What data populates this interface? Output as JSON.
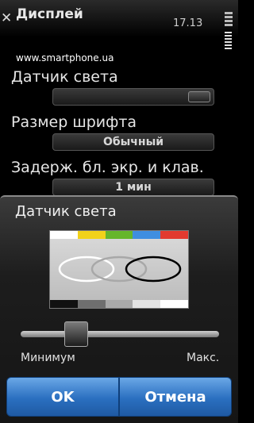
{
  "header": {
    "title": "Дисплей",
    "time": "17.13"
  },
  "watermark": "www.smartphone.ua",
  "settings": [
    {
      "label": "Датчик света",
      "value": ""
    },
    {
      "label": "Размер шрифта",
      "value": "Обычный"
    },
    {
      "label": "Задерж. бл. экр. и клав.",
      "value": "1 мин"
    }
  ],
  "dialog": {
    "title": "Датчик света",
    "slider_value_fraction": 0.25,
    "min_label": "Минимум",
    "max_label": "Макс.",
    "ok_label": "OK",
    "cancel_label": "Отмена",
    "preview_colors_top": [
      "#ffffff",
      "#f2d21a",
      "#66b62b",
      "#3f8ee0",
      "#e23a2f"
    ],
    "preview_colors_bottom": [
      "#111111",
      "#6f6f6f",
      "#a9a9a9",
      "#e3e3e3",
      "#ffffff"
    ]
  },
  "icons": {
    "close": "close-icon",
    "battery": "battery-icon",
    "signal": "signal-icon"
  }
}
